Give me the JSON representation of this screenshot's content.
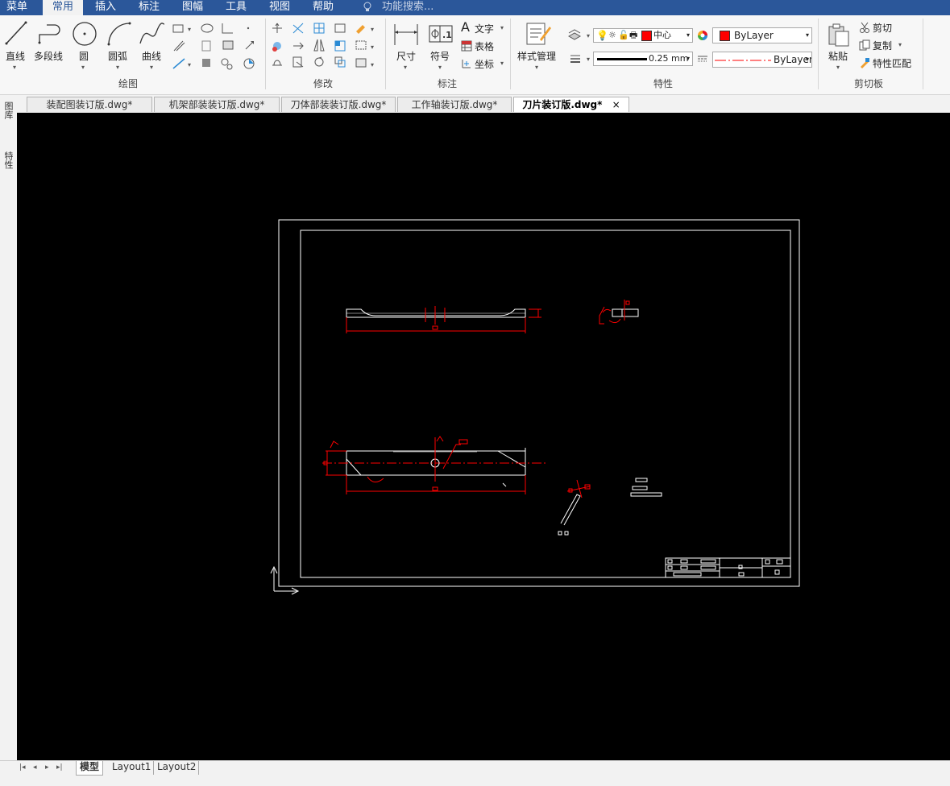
{
  "menubar": {
    "items": [
      "菜单",
      "常用",
      "插入",
      "标注",
      "图幅",
      "工具",
      "视图",
      "帮助"
    ],
    "search_placeholder": "功能搜索..."
  },
  "ribbon": {
    "draw": {
      "group_label": "绘图",
      "line": "直线",
      "polyline": "多段线",
      "circle": "圆",
      "arc": "圆弧",
      "curve": "曲线"
    },
    "modify": {
      "group_label": "修改"
    },
    "annotate": {
      "group_label": "标注",
      "dimension": "尺寸",
      "symbol": "符号",
      "text": "文字",
      "table": "表格",
      "coordinate": "坐标"
    },
    "properties": {
      "group_label": "特性",
      "style_manager": "样式管理",
      "layer_value": "中心",
      "color_value": "ByLayer",
      "lineweight_value": "0.25 mm",
      "linetype_value": "ByLayer"
    },
    "clipboard": {
      "group_label": "剪切板",
      "paste": "粘贴",
      "cut": "剪切",
      "copy": "复制",
      "match": "特性匹配"
    }
  },
  "tabs": [
    {
      "label": "装配图装订版.dwg*"
    },
    {
      "label": "机架部装装订版.dwg*"
    },
    {
      "label": "刀体部装装订版.dwg*"
    },
    {
      "label": "工作轴装订版.dwg*"
    },
    {
      "label": "刀片装订版.dwg*"
    }
  ],
  "tab_close": "×",
  "sidebar": {
    "panel1": "图库",
    "panel2": "特性"
  },
  "bottom": {
    "tabs": [
      "模型",
      "Layout1",
      "Layout2"
    ]
  },
  "colors": {
    "menubar": "#2b579a",
    "canvas": "#000000",
    "dim_red": "#ff0000",
    "entity_white": "#ffffff",
    "accent_red": "#e81123"
  }
}
